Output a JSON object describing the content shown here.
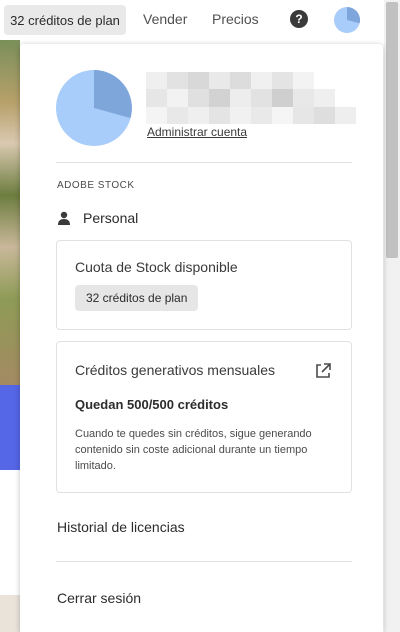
{
  "topbar": {
    "credits_label": "32 créditos de plan",
    "nav": [
      {
        "label": "Vender"
      },
      {
        "label": "Precios"
      }
    ],
    "help_glyph": "?",
    "icons": {
      "help": "question-circle-icon",
      "avatar": "user-avatar-icon"
    }
  },
  "colors": {
    "avatar_light": "#a9cdfa",
    "avatar_dark": "#7fa6da",
    "accent_blue": "#5566e6"
  },
  "account": {
    "manage_link": "Administrar cuenta"
  },
  "stock": {
    "section_label": "ADOBE STOCK",
    "profile_label": "Personal",
    "quota": {
      "title": "Cuota de Stock disponible",
      "credits_pill": "32 créditos de plan"
    },
    "generative": {
      "title": "Créditos generativos mensuales",
      "remaining": "Quedan 500/500 créditos",
      "description": "Cuando te quedes sin créditos, sigue generando contenido sin coste adicional durante un tiempo limitado."
    }
  },
  "menu": {
    "license_history": "Historial de licencias",
    "sign_out": "Cerrar sesión"
  }
}
